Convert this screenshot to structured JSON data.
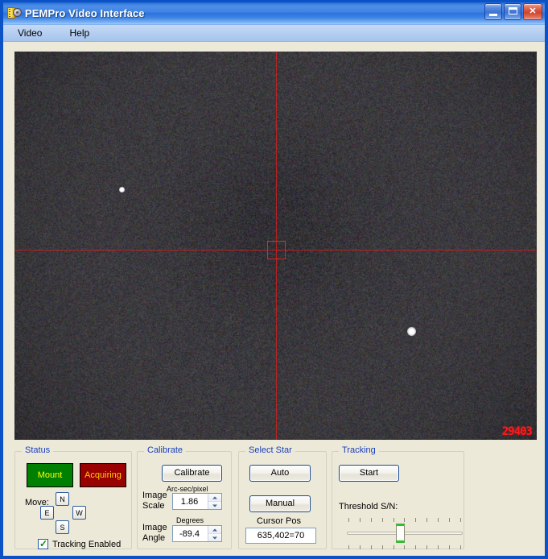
{
  "window": {
    "title": "PEMPro Video Interface",
    "icon": "film-gear-icon",
    "buttons": {
      "minimize": "minimize-button",
      "maximize": "maximize-button",
      "close_glyph": "✕"
    }
  },
  "menubar": {
    "items": [
      {
        "label": "Video"
      },
      {
        "label": "Help"
      }
    ]
  },
  "video": {
    "frame_counter": "29403",
    "crosshair_color": "#d02020",
    "background_color": "#000000"
  },
  "status": {
    "group_title": "Status",
    "mount_label": "Mount",
    "mount_color": "#008000",
    "mount_text_color": "#ffff00",
    "acquiring_label": "Acquiring",
    "acquiring_color": "#990000",
    "acquiring_text_color": "#ffcc00",
    "move_label": "Move:",
    "move_north": "N",
    "move_east": "E",
    "move_west": "W",
    "move_south": "S",
    "tracking_enabled_label": "Tracking Enabled",
    "tracking_enabled_checked": true
  },
  "calibrate": {
    "group_title": "Calibrate",
    "calibrate_button": "Calibrate",
    "image_scale_label_line1": "Image",
    "image_scale_label_line2": "Scale",
    "arcsec_per_pixel_label": "Arc-sec/pixel",
    "image_scale_value": "1.86",
    "image_angle_label_line1": "Image",
    "image_angle_label_line2": "Angle",
    "degrees_label": "Degrees",
    "image_angle_value": "-89.4"
  },
  "select_star": {
    "group_title": "Select Star",
    "auto_button": "Auto",
    "manual_button": "Manual",
    "cursor_pos_label": "Cursor Pos",
    "cursor_pos_value": "635,402=70"
  },
  "tracking": {
    "group_title": "Tracking",
    "start_button": "Start",
    "threshold_label": "Threshold S/N:",
    "slider_percent": 46,
    "slider_tick_count": 11,
    "thumb_color": "#2fbe2f"
  },
  "theme": {
    "window_bg": "#ece9d8",
    "titlebar_blue": "#0a52c6",
    "group_title_color": "#1a3fbf",
    "button_border": "#1c4a8f"
  }
}
